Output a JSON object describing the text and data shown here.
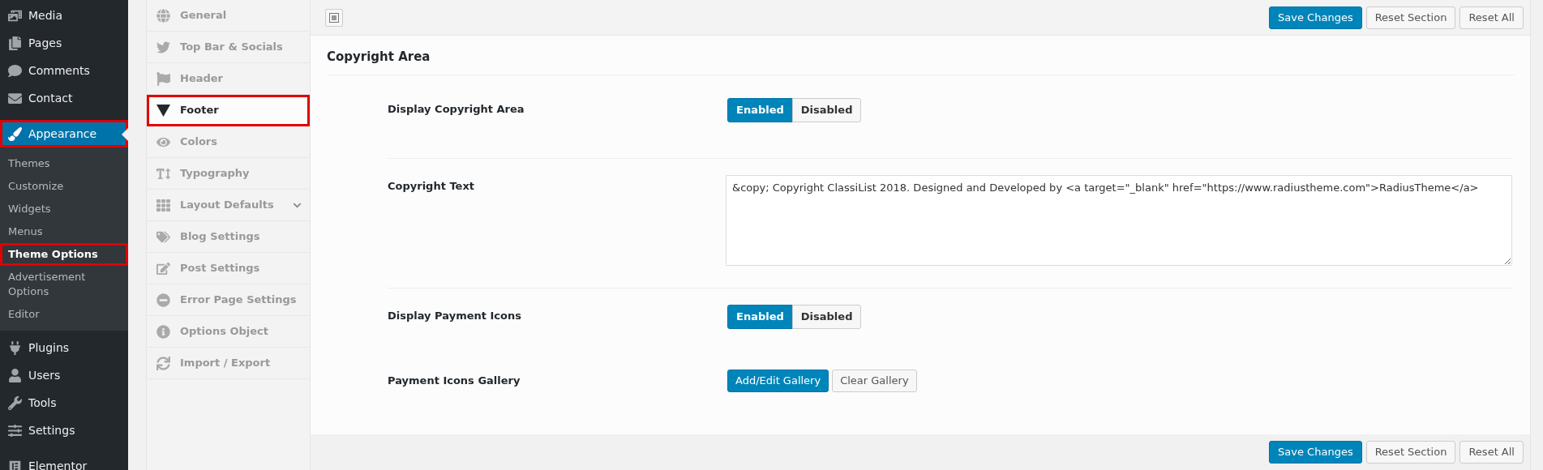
{
  "admin_menu": [
    {
      "label": "Media",
      "selected": false,
      "highlighted": false
    },
    {
      "label": "Pages",
      "selected": false,
      "highlighted": false
    },
    {
      "label": "Comments",
      "selected": false,
      "highlighted": false
    },
    {
      "label": "Contact",
      "selected": false,
      "highlighted": false
    },
    {
      "label": "Appearance",
      "selected": true,
      "highlighted": true,
      "children": [
        {
          "label": "Themes",
          "selected": false,
          "highlighted": false
        },
        {
          "label": "Customize",
          "selected": false,
          "highlighted": false
        },
        {
          "label": "Widgets",
          "selected": false,
          "highlighted": false
        },
        {
          "label": "Menus",
          "selected": false,
          "highlighted": false
        },
        {
          "label": "Theme Options",
          "selected": true,
          "highlighted": true
        },
        {
          "label": "Advertisement Options",
          "selected": false,
          "highlighted": false
        },
        {
          "label": "Editor",
          "selected": false,
          "highlighted": false
        }
      ]
    },
    {
      "label": "Plugins",
      "selected": false,
      "highlighted": false
    },
    {
      "label": "Users",
      "selected": false,
      "highlighted": false
    },
    {
      "label": "Tools",
      "selected": false,
      "highlighted": false
    },
    {
      "label": "Settings",
      "selected": false,
      "highlighted": false
    },
    {
      "label": "Elementor",
      "selected": false,
      "highlighted": false
    }
  ],
  "options_menu": [
    {
      "label": "General",
      "selected": false,
      "highlighted": false,
      "has_submenu": false
    },
    {
      "label": "Top Bar & Socials",
      "selected": false,
      "highlighted": false,
      "has_submenu": false
    },
    {
      "label": "Header",
      "selected": false,
      "highlighted": false,
      "has_submenu": false
    },
    {
      "label": "Footer",
      "selected": true,
      "highlighted": true,
      "has_submenu": false
    },
    {
      "label": "Colors",
      "selected": false,
      "highlighted": false,
      "has_submenu": false
    },
    {
      "label": "Typography",
      "selected": false,
      "highlighted": false,
      "has_submenu": false
    },
    {
      "label": "Layout Defaults",
      "selected": false,
      "highlighted": false,
      "has_submenu": true
    },
    {
      "label": "Blog Settings",
      "selected": false,
      "highlighted": false,
      "has_submenu": false
    },
    {
      "label": "Post Settings",
      "selected": false,
      "highlighted": false,
      "has_submenu": false
    },
    {
      "label": "Error Page Settings",
      "selected": false,
      "highlighted": false,
      "has_submenu": false
    },
    {
      "label": "Options Object",
      "selected": false,
      "highlighted": false,
      "has_submenu": false
    },
    {
      "label": "Import / Export",
      "selected": false,
      "highlighted": false,
      "has_submenu": false
    }
  ],
  "top_bar": {
    "buttons": [
      {
        "label": "Save Changes",
        "kind": "primary"
      },
      {
        "label": "Reset Section",
        "kind": "secondary"
      },
      {
        "label": "Reset All",
        "kind": "secondary"
      }
    ]
  },
  "section": {
    "title": "Copyright Area",
    "fields": [
      {
        "kind": "toggle",
        "label": "Display Copyright Area",
        "options": [
          {
            "label": "Enabled",
            "selected": true
          },
          {
            "label": "Disabled",
            "selected": false
          }
        ]
      },
      {
        "kind": "textarea",
        "label": "Copyright Text",
        "value": "&copy; Copyright ClassiList 2018. Designed and Developed by <a target=\"_blank\" href=\"https://www.radiustheme.com\">RadiusTheme</a>"
      },
      {
        "kind": "toggle",
        "label": "Display Payment Icons",
        "options": [
          {
            "label": "Enabled",
            "selected": true
          },
          {
            "label": "Disabled",
            "selected": false
          }
        ]
      },
      {
        "kind": "buttons",
        "label": "Payment Icons Gallery",
        "buttons": [
          {
            "label": "Add/Edit Gallery",
            "kind": "primary"
          },
          {
            "label": "Clear Gallery",
            "kind": "secondary"
          }
        ]
      }
    ]
  },
  "bottom_bar": {
    "buttons": [
      {
        "label": "Save Changes",
        "kind": "primary"
      },
      {
        "label": "Reset Section",
        "kind": "secondary"
      },
      {
        "label": "Reset All",
        "kind": "secondary"
      }
    ]
  }
}
